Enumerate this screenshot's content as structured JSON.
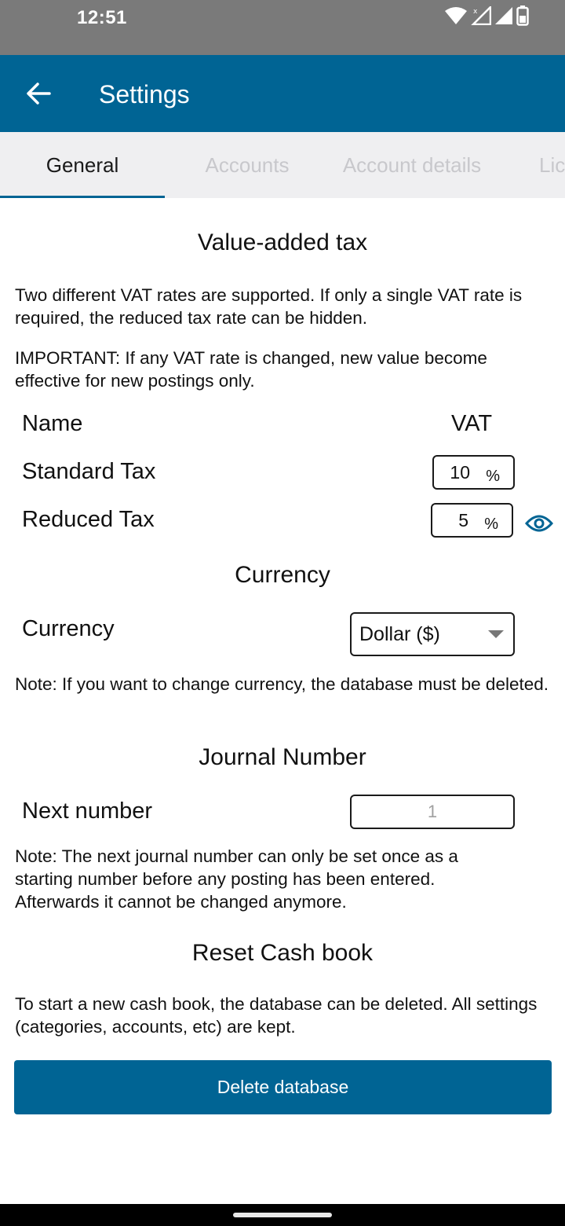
{
  "status_bar": {
    "time": "12:51"
  },
  "app_bar": {
    "title": "Settings"
  },
  "tabs": [
    {
      "label": "General",
      "active": true
    },
    {
      "label": "Accounts",
      "active": false
    },
    {
      "label": "Account details",
      "active": false
    },
    {
      "label": "Lic",
      "active": false
    }
  ],
  "vat": {
    "title": "Value-added tax",
    "description": "Two different VAT rates are supported. If only a single VAT rate is required, the reduced tax rate can be hidden.",
    "important": "IMPORTANT: If any VAT rate is changed, new value become effective for new postings only.",
    "col_name": "Name",
    "col_vat": "VAT",
    "rows": [
      {
        "name": "Standard Tax",
        "value": "10",
        "unit": "%"
      },
      {
        "name": "Reduced Tax",
        "value": "5",
        "unit": "%"
      }
    ]
  },
  "currency": {
    "title": "Currency",
    "label": "Currency",
    "selected": "Dollar ($)",
    "note": "Note: If you want to change currency, the database must be deleted."
  },
  "journal": {
    "title": "Journal Number",
    "label": "Next number",
    "placeholder": "1",
    "note": "Note: The next journal number can only be set once as a starting number before any posting has been entered. Afterwards it cannot be changed anymore."
  },
  "reset": {
    "title": "Reset Cash book",
    "description": "To start a new cash book, the database can be deleted. All settings (categories, accounts, etc) are kept.",
    "button": "Delete database"
  },
  "colors": {
    "primary": "#006494",
    "status_bar": "#7a7a7a",
    "tab_bar": "#efeff1"
  }
}
